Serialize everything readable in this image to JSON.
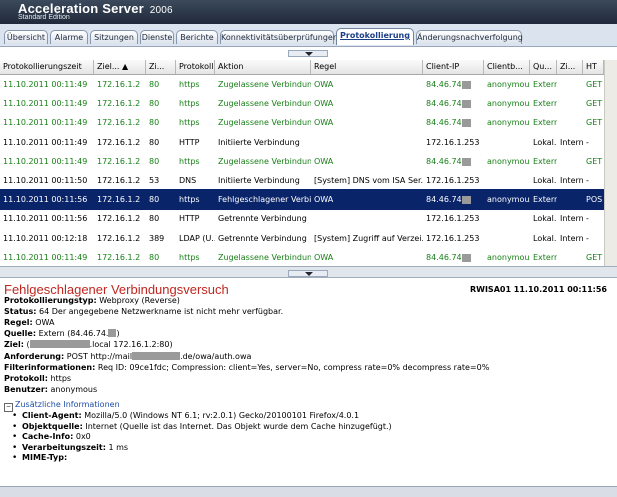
{
  "app": {
    "title": "Acceleration Server",
    "version": "2006",
    "edition": "Standard Edition"
  },
  "tabs": [
    {
      "label": "Übersicht"
    },
    {
      "label": "Alarme"
    },
    {
      "label": "Sitzungen"
    },
    {
      "label": "Dienste"
    },
    {
      "label": "Berichte"
    },
    {
      "label": "Konnektivitätsüberprüfungen"
    },
    {
      "label": "Protokollierung",
      "active": true
    },
    {
      "label": "Änderungsnachverfolgung"
    }
  ],
  "table": {
    "columns": [
      "Protokollierungszeit",
      "Ziel...",
      "Zi...",
      "Protokoll",
      "Aktion",
      "Regel",
      "Client-IP",
      "Clientb...",
      "Qu...",
      "Zi...",
      "HT"
    ],
    "sorted_column": "Ziel...",
    "rows": [
      {
        "time": "11.10.2011 00:11:49",
        "dest": "172.16.1.2",
        "port": "80",
        "proto": "https",
        "action": "Zugelassene Verbindung",
        "rule": "OWA",
        "ip": "84.46.74.",
        "user": "anonymous",
        "src": "Extern",
        "dst": "",
        "ht": "GET",
        "style": "green"
      },
      {
        "time": "11.10.2011 00:11:49",
        "dest": "172.16.1.2",
        "port": "80",
        "proto": "https",
        "action": "Zugelassene Verbindung",
        "rule": "OWA",
        "ip": "84.46.74.",
        "user": "anonymous",
        "src": "Extern",
        "dst": "",
        "ht": "GET",
        "style": "green"
      },
      {
        "time": "11.10.2011 00:11:49",
        "dest": "172.16.1.2",
        "port": "80",
        "proto": "https",
        "action": "Zugelassene Verbindung",
        "rule": "OWA",
        "ip": "84.46.74.",
        "user": "anonymous",
        "src": "Extern",
        "dst": "",
        "ht": "GET",
        "style": "green"
      },
      {
        "time": "11.10.2011 00:11:49",
        "dest": "172.16.1.2",
        "port": "80",
        "proto": "HTTP",
        "action": "Initiierte Verbindung",
        "rule": "",
        "ip": "172.16.1.253",
        "user": "",
        "src": "Lokal...",
        "dst": "Intern",
        "ht": "-",
        "style": "normal"
      },
      {
        "time": "11.10.2011 00:11:49",
        "dest": "172.16.1.2",
        "port": "80",
        "proto": "https",
        "action": "Zugelassene Verbindung",
        "rule": "OWA",
        "ip": "84.46.74.",
        "user": "anonymous",
        "src": "Extern",
        "dst": "",
        "ht": "GET",
        "style": "green"
      },
      {
        "time": "11.10.2011 00:11:50",
        "dest": "172.16.1.2",
        "port": "53",
        "proto": "DNS",
        "action": "Initiierte Verbindung",
        "rule": "[System] DNS vom ISA Ser...",
        "ip": "172.16.1.253",
        "user": "",
        "src": "Lokal...",
        "dst": "Intern",
        "ht": "-",
        "style": "normal"
      },
      {
        "time": "11.10.2011 00:11:56",
        "dest": "172.16.1.2",
        "port": "80",
        "proto": "https",
        "action": "Fehlgeschlagener Verbi...",
        "rule": "OWA",
        "ip": "84.46.74.",
        "user": "anonymous",
        "src": "Extern",
        "dst": "",
        "ht": "POS",
        "style": "selected"
      },
      {
        "time": "11.10.2011 00:11:56",
        "dest": "172.16.1.2",
        "port": "80",
        "proto": "HTTP",
        "action": "Getrennte Verbindung",
        "rule": "",
        "ip": "172.16.1.253",
        "user": "",
        "src": "Lokal...",
        "dst": "Intern",
        "ht": "-",
        "style": "normal"
      },
      {
        "time": "11.10.2011 00:12:18",
        "dest": "172.16.1.2",
        "port": "389",
        "proto": "LDAP (U...",
        "action": "Getrennte Verbindung",
        "rule": "[System] Zugriff auf Verzei...",
        "ip": "172.16.1.253",
        "user": "",
        "src": "Lokal...",
        "dst": "Intern",
        "ht": "-",
        "style": "normal"
      },
      {
        "time": "11.10.2011 00:11:49",
        "dest": "172.16.1.2",
        "port": "80",
        "proto": "https",
        "action": "Zugelassene Verbindung",
        "rule": "OWA",
        "ip": "84.46.74.",
        "user": "anonymous",
        "src": "Extern",
        "dst": "",
        "ht": "GET",
        "style": "green"
      }
    ]
  },
  "details": {
    "heading": "Fehlgeschlagener Verbindungsversuch",
    "server_stamp": "RWISA01 11.10.2011 00:11:56",
    "fields": [
      {
        "label": "Protokollierungstyp:",
        "value": "Webproxy (Reverse)"
      },
      {
        "label": "Status:",
        "value": "64 Der angegebene Netzwerkname ist nicht mehr verfügbar."
      },
      {
        "label": "Regel:",
        "value": "OWA"
      },
      {
        "label": "Quelle:",
        "value": "Extern (84.46.74.",
        "suffix": ")"
      },
      {
        "label": "Ziel:",
        "value": "(",
        "suffix": ".local 172.16.1.2:80)"
      },
      {
        "label": "Anforderung:",
        "value": "POST http://mail",
        "suffix": ".de/owa/auth.owa"
      },
      {
        "label": "Filterinformationen:",
        "value": "Req ID: 09ce1fdc; Compression: client=Yes, server=No, compress rate=0% decompress rate=0%"
      },
      {
        "label": "Protokoll:",
        "value": "https"
      },
      {
        "label": "Benutzer:",
        "value": "anonymous"
      }
    ],
    "additional_label": "Zusätzliche Informationen",
    "additional": [
      {
        "label": "Client-Agent:",
        "value": "Mozilla/5.0 (Windows NT 6.1; rv:2.0.1) Gecko/20100101 Firefox/4.0.1"
      },
      {
        "label": "Objektquelle:",
        "value": "Internet (Quelle ist das Internet. Das Objekt wurde dem Cache hinzugefügt.)"
      },
      {
        "label": "Cache-Info:",
        "value": "0x0"
      },
      {
        "label": "Verarbeitungszeit:",
        "value": "1 ms"
      },
      {
        "label": "MIME-Typ:",
        "value": ""
      }
    ]
  },
  "colors": {
    "selected_row": "#0a246a",
    "allowed_text": "#188018",
    "heading_red": "#c0261f",
    "link_blue": "#1f4ea8"
  }
}
